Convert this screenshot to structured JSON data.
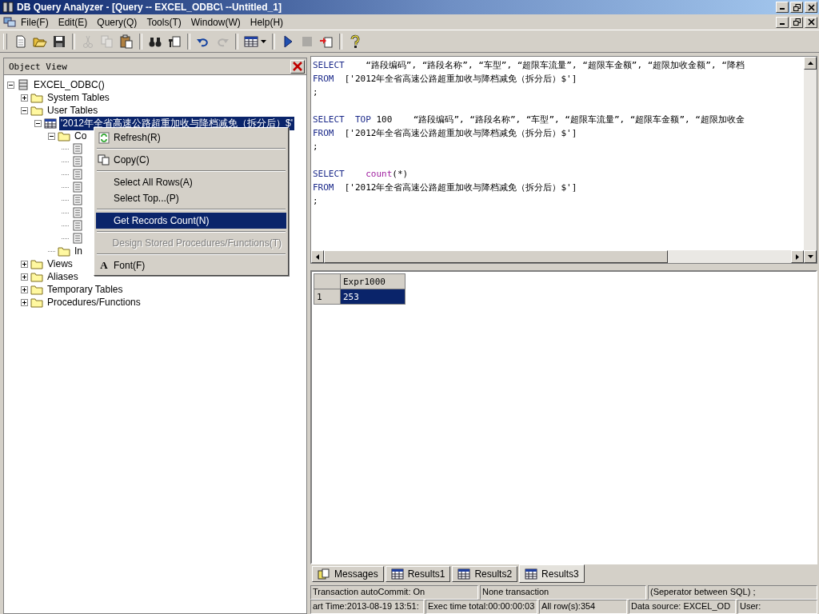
{
  "window": {
    "title": "DB Query Analyzer - [Query -- EXCEL_ODBC\\  --Untitled_1]"
  },
  "menu": [
    {
      "label": "File(F)"
    },
    {
      "label": "Edit(E)"
    },
    {
      "label": "Query(Q)"
    },
    {
      "label": "Tools(T)"
    },
    {
      "label": "Window(W)"
    },
    {
      "label": "Help(H)"
    }
  ],
  "toolbar": [
    {
      "kind": "new",
      "disabled": false
    },
    {
      "kind": "open",
      "disabled": false
    },
    {
      "kind": "save",
      "disabled": false
    },
    {
      "kind": "separator"
    },
    {
      "kind": "cut",
      "disabled": true
    },
    {
      "kind": "copy",
      "disabled": true
    },
    {
      "kind": "paste",
      "disabled": false
    },
    {
      "kind": "separator"
    },
    {
      "kind": "find",
      "disabled": false
    },
    {
      "kind": "replace",
      "disabled": false
    },
    {
      "kind": "separator"
    },
    {
      "kind": "undo",
      "disabled": false
    },
    {
      "kind": "redo",
      "disabled": true
    },
    {
      "kind": "separator"
    },
    {
      "kind": "grid",
      "disabled": false
    },
    {
      "kind": "separator"
    },
    {
      "kind": "run",
      "disabled": false
    },
    {
      "kind": "stop",
      "disabled": true
    },
    {
      "kind": "export",
      "disabled": false
    },
    {
      "kind": "separator"
    },
    {
      "kind": "help",
      "disabled": false
    }
  ],
  "object_view": {
    "title": "Object View",
    "tree": [
      {
        "kind": "server",
        "label": "EXCEL_ODBC()",
        "expanded": true,
        "selected": false,
        "children": [
          {
            "kind": "folder",
            "label": "System Tables",
            "expanded": false,
            "selected": false
          },
          {
            "kind": "folder",
            "label": "User Tables",
            "expanded": true,
            "selected": false,
            "children": [
              {
                "kind": "table",
                "label": "'2012年全省高速公路超重加收与降档减免（拆分后）$'",
                "expanded": true,
                "selected": true,
                "children": [
                  {
                    "kind": "folder",
                    "label": "Co",
                    "expanded": true,
                    "selected": false,
                    "children": [
                      {
                        "kind": "column"
                      },
                      {
                        "kind": "column"
                      },
                      {
                        "kind": "column"
                      },
                      {
                        "kind": "column"
                      },
                      {
                        "kind": "column"
                      },
                      {
                        "kind": "column"
                      },
                      {
                        "kind": "column"
                      },
                      {
                        "kind": "column"
                      }
                    ]
                  },
                  {
                    "kind": "folder",
                    "label": "In",
                    "selected": false
                  }
                ]
              }
            ]
          },
          {
            "kind": "folder",
            "label": "Views",
            "expanded": false,
            "selected": false
          },
          {
            "kind": "folder",
            "label": "Aliases",
            "expanded": false,
            "selected": false
          },
          {
            "kind": "folder",
            "label": "Temporary Tables",
            "expanded": false,
            "selected": false
          },
          {
            "kind": "folder",
            "label": "Procedures/Functions",
            "expanded": false,
            "selected": false
          }
        ]
      }
    ]
  },
  "context_menu": [
    {
      "kind": "refresh",
      "label": "Refresh(R)",
      "selected": false,
      "disabled": false
    },
    {
      "kind": "separator"
    },
    {
      "kind": "copy",
      "label": "Copy(C)",
      "selected": false,
      "disabled": false
    },
    {
      "kind": "separator"
    },
    {
      "kind": "item",
      "label": "Select All Rows(A)",
      "selected": false,
      "disabled": false
    },
    {
      "kind": "item",
      "label": "Select Top...(P)",
      "selected": false,
      "disabled": false
    },
    {
      "kind": "separator"
    },
    {
      "kind": "item",
      "label": "Get Records Count(N)",
      "selected": true,
      "disabled": false
    },
    {
      "kind": "separator"
    },
    {
      "kind": "item",
      "label": "Design Stored Procedures/Functions(T)",
      "selected": false,
      "disabled": true
    },
    {
      "kind": "separator"
    },
    {
      "kind": "font",
      "glyph": "A",
      "label": "Font(F)",
      "selected": false,
      "disabled": false
    }
  ],
  "editor": {
    "lines": [
      {
        "tokens": [
          {
            "kind": "keyword",
            "text": "SELECT"
          },
          {
            "kind": "text",
            "text": "    “路段编码”, “路段名称”, “车型”, “超限车流量”, “超限车金额”, “超限加收金额”, “降档"
          }
        ]
      },
      {
        "tokens": [
          {
            "kind": "keyword",
            "text": "FROM"
          },
          {
            "kind": "text",
            "text": "  ['2012年全省高速公路超重加收与降档减免（拆分后）$']"
          }
        ]
      },
      {
        "tokens": [
          {
            "kind": "text",
            "text": ";"
          }
        ]
      },
      {
        "space_before": true,
        "tokens": [
          {
            "kind": "keyword",
            "text": "SELECT"
          },
          {
            "kind": "keyword",
            "text": "  TOP"
          },
          {
            "kind": "text",
            "text": " 100    “路段编码”, “路段名称”, “车型”, “超限车流量”, “超限车金额”, “超限加收金"
          }
        ]
      },
      {
        "tokens": [
          {
            "kind": "keyword",
            "text": "FROM"
          },
          {
            "kind": "text",
            "text": "  ['2012年全省高速公路超重加收与降档减免（拆分后）$']"
          }
        ]
      },
      {
        "tokens": [
          {
            "kind": "text",
            "text": ";"
          }
        ]
      },
      {
        "space_before": true,
        "tokens": [
          {
            "kind": "keyword",
            "text": "SELECT"
          },
          {
            "kind": "function",
            "text": "    count"
          },
          {
            "kind": "text",
            "text": "(*)"
          }
        ]
      },
      {
        "tokens": [
          {
            "kind": "keyword",
            "text": "FROM"
          },
          {
            "kind": "text",
            "text": "  ['2012年全省高速公路超重加收与降档减免（拆分后）$']"
          }
        ]
      },
      {
        "tokens": [
          {
            "kind": "text",
            "text": ";"
          }
        ]
      }
    ]
  },
  "results": {
    "columns": [
      "Expr1000"
    ],
    "rows": [
      {
        "number": "1",
        "cells": [
          "253"
        ],
        "selected": true
      }
    ]
  },
  "result_tabs": [
    {
      "kind": "messages",
      "label": "Messages",
      "selected": false
    },
    {
      "kind": "grid",
      "label": "Results1",
      "selected": false
    },
    {
      "kind": "grid",
      "label": "Results2",
      "selected": false
    },
    {
      "kind": "grid",
      "label": "Results3",
      "selected": true
    }
  ],
  "status_bar": {
    "row_1": [
      "Transaction autoCommit: On",
      "None transaction",
      "(Seperator between SQL)  ;"
    ],
    "row_2": [
      "art Time:2013-08-19 13:51:",
      "Exec time total:00:00:00:03",
      "All row(s):354",
      "Data source: EXCEL_OD",
      "User:"
    ]
  }
}
